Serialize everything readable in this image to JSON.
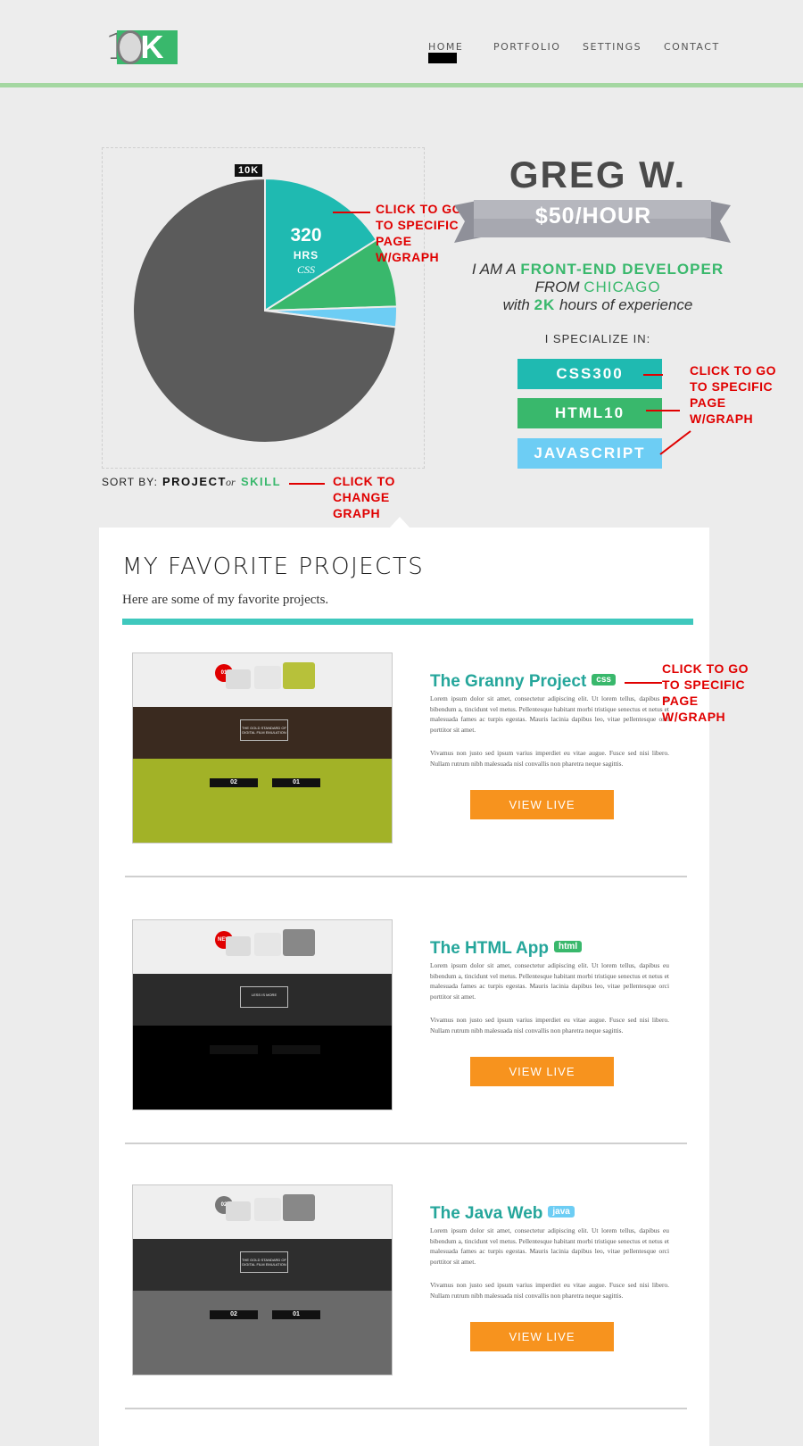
{
  "header": {
    "logo_one": "1",
    "logo_k": "K",
    "nav": [
      "HOME",
      "PORTFOLIO",
      "SETTINGS",
      "CONTACT"
    ]
  },
  "chart_data": {
    "type": "pie",
    "tag": "10K",
    "slices": [
      {
        "value": 320,
        "color": "#1fbab1"
      },
      {
        "value": 170,
        "color": "#39b86c"
      },
      {
        "value": 50,
        "color": "#6dcdf4"
      },
      {
        "value": 1460,
        "color": "#5b5b5b"
      }
    ],
    "highlight": {
      "value": "320",
      "unit": "HRS",
      "skill": "CSS"
    }
  },
  "sort": {
    "label": "SORT BY:",
    "project": "PROJECT",
    "or": "or",
    "skill": "SKILL"
  },
  "profile": {
    "name": "GREG W.",
    "rate": "$50/HOUR",
    "line1_a": "I AM A",
    "line1_b": "FRONT-END DEVELOPER",
    "line2_a": "FROM",
    "line2_b": "CHICAGO",
    "line3_a": "with",
    "line3_b": "2K",
    "line3_c": "hours of experience",
    "specialize": "I SPECIALIZE IN:",
    "skills": [
      {
        "label": "CSS300",
        "color": "#1fbab1"
      },
      {
        "label": "HTML10",
        "color": "#39b86c"
      },
      {
        "label": "JAVASCRIPT",
        "color": "#6dcdf4"
      }
    ]
  },
  "annotations": {
    "graph": [
      "CLICK TO GO",
      "TO SPECIFIC",
      "PAGE",
      "W/GRAPH"
    ],
    "change": [
      "CLICK TO",
      "CHANGE",
      "GRAPH"
    ]
  },
  "projects_section": {
    "title": "MY FAVORITE PROJECTS",
    "subtitle": "Here are some of my favorite projects."
  },
  "projects": [
    {
      "title": "The Granny Project",
      "badge": "css",
      "badge_color": "#39b86c",
      "p1": "Lorem ipsum dolor sit amet, consectetur adipiscing elit. Ut lorem tellus, dapibus eu bibendum a, tincidunt vel metus. Pellentesque habitant morbi tristique senectus et netus et malesuada fames ac turpis egestas. Mauris lacinia dapibus leo, vitae pellentesque orci porttitor sit amet.",
      "p2": "Vivamus non justo sed ipsum varius imperdiet eu vitae augue. Fusce sed nisi libero. Nullam rutrum nibh malesuada nisl convallis non pharetra neque sagittis.",
      "button": "VIEW LIVE"
    },
    {
      "title": "The HTML App",
      "badge": "html",
      "badge_color": "#39b86c",
      "p1": "Lorem ipsum dolor sit amet, consectetur adipiscing elit. Ut lorem tellus, dapibus eu bibendum a, tincidunt vel metus. Pellentesque habitant morbi tristique senectus et netus et malesuada fames ac turpis egestas. Mauris lacinia dapibus leo, vitae pellentesque orci porttitor sit amet.",
      "p2": "Vivamus non justo sed ipsum varius imperdiet eu vitae augue. Fusce sed nisi libero. Nullam rutrum nibh malesuada nisl convallis non pharetra neque sagittis.",
      "button": "VIEW LIVE"
    },
    {
      "title": "The Java Web",
      "badge": "java",
      "badge_color": "#6dcdf4",
      "p1": "Lorem ipsum dolor sit amet, consectetur adipiscing elit. Ut lorem tellus, dapibus eu bibendum a, tincidunt vel metus. Pellentesque habitant morbi tristique senectus et netus et malesuada fames ac turpis egestas. Mauris lacinia dapibus leo, vitae pellentesque orci porttitor sit amet.",
      "p2": "Vivamus non justo sed ipsum varius imperdiet eu vitae augue. Fusce sed nisi libero. Nullam rutrum nibh malesuada nisl convallis non pharetra neque sagittis.",
      "button": "VIEW LIVE"
    }
  ],
  "thumbs": [
    {
      "band_color": "#a2b227",
      "mid_color": "#3a2a1f",
      "badge": "01",
      "badge_color": "#e00000",
      "headline": "THE GOLD STANDARD OF DIGITAL FILM EMULATION",
      "counter_a": "02",
      "counter_b": "01"
    },
    {
      "band_color": "#000000",
      "mid_color": "#2b2b2b",
      "badge": "NEW",
      "badge_color": "#e00000",
      "headline": "LESS IS MORE",
      "counter_a": "",
      "counter_b": ""
    },
    {
      "band_color": "#6a6a6a",
      "mid_color": "#2e2e2e",
      "badge": "02",
      "badge_color": "#777777",
      "headline": "THE GOLD STANDARD OF DIGITAL FILM EMULATION",
      "counter_a": "02",
      "counter_b": "01"
    }
  ]
}
